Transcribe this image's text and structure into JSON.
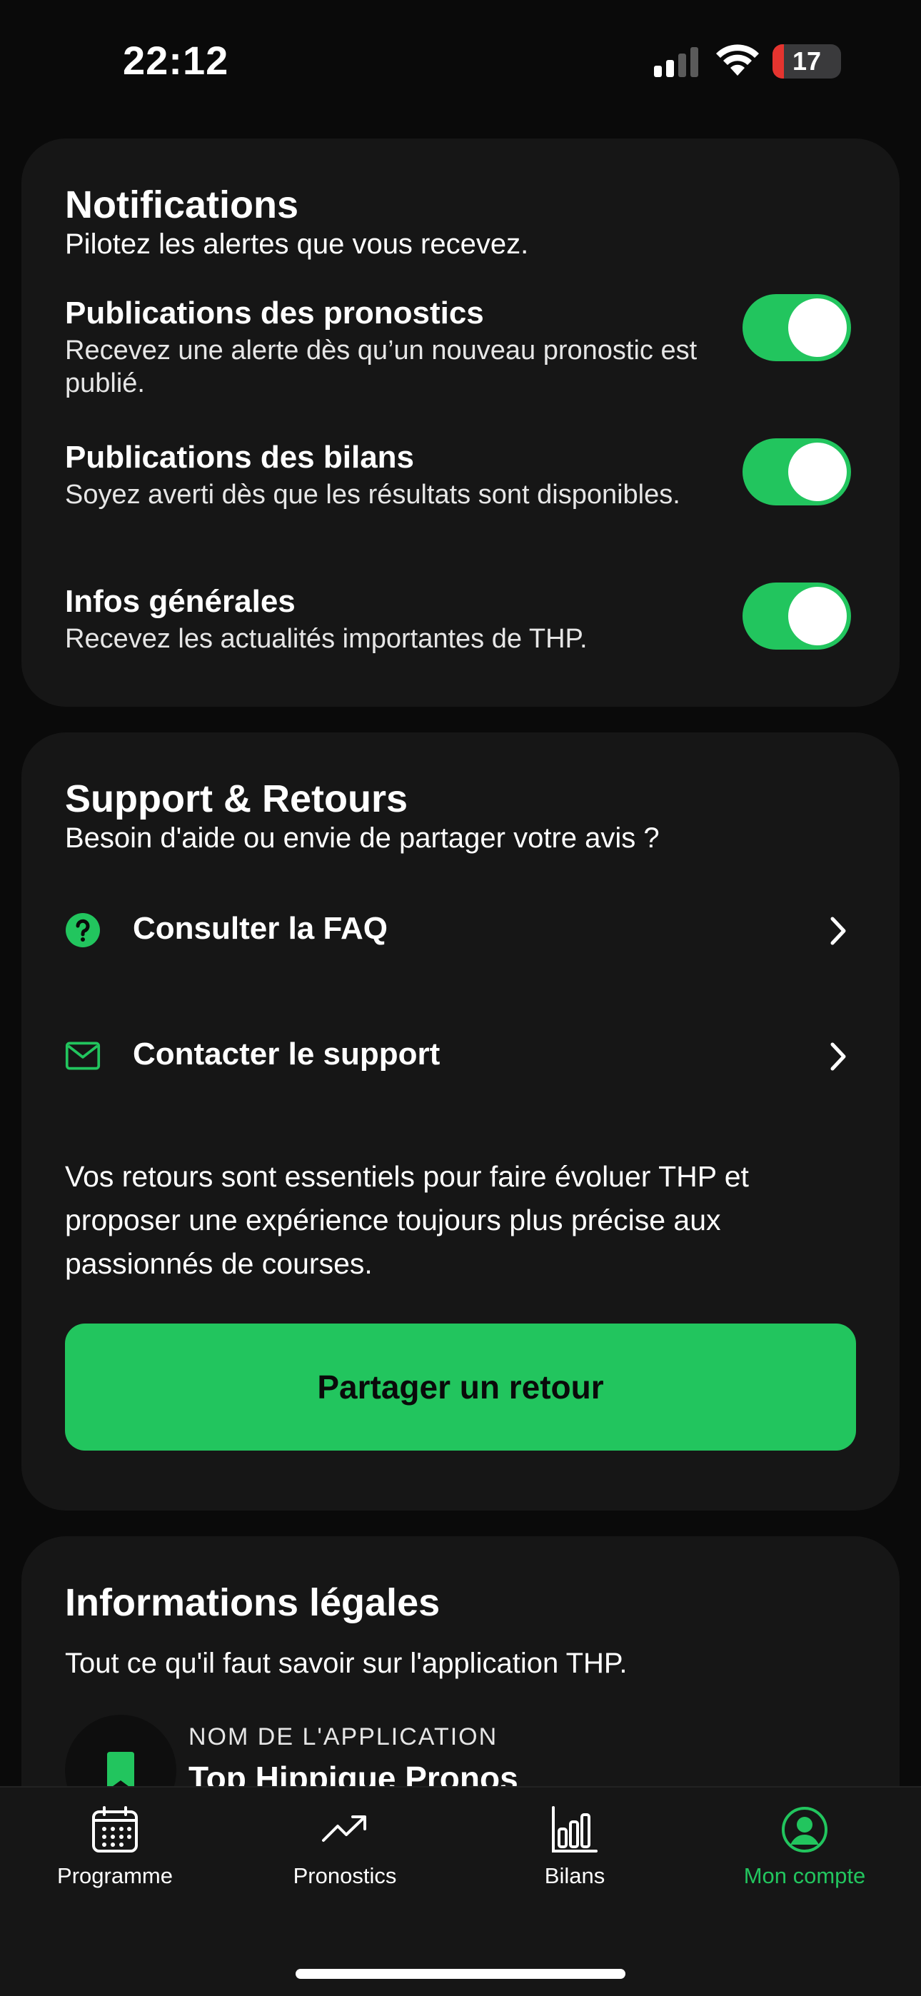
{
  "status_bar": {
    "time": "22:12",
    "battery_level": "17",
    "battery_fraction": 0.17
  },
  "notifications": {
    "title": "Notifications",
    "subtitle": "Pilotez les alertes que vous recevez.",
    "items": [
      {
        "title": "Publications des pronostics",
        "desc": "Recevez une alerte dès qu’un nouveau pronostic est publié.",
        "enabled": true
      },
      {
        "title": "Publications des bilans",
        "desc": "Soyez averti dès que les résultats sont disponibles.",
        "enabled": true
      },
      {
        "title": "Infos générales",
        "desc": "Recevez les actualités importantes de THP.",
        "enabled": true
      }
    ]
  },
  "support": {
    "title": "Support & Retours",
    "subtitle": "Besoin d'aide ou envie de partager votre avis ?",
    "faq_label": "Consulter la FAQ",
    "contact_label": "Contacter le support",
    "feedback_text": "Vos retours sont essentiels pour faire évoluer THP et proposer une expérience toujours plus précise aux passionnés de courses.",
    "cta_label": "Partager un retour"
  },
  "legal": {
    "title": "Informations légales",
    "subtitle": "Tout ce qu'il faut savoir sur l'application THP.",
    "app_name_label": "NOM DE L'APPLICATION",
    "app_name_value": "Top Hippique Pronos"
  },
  "tab_bar": {
    "items": [
      {
        "label": "Programme",
        "icon": "calendar-icon",
        "active": false
      },
      {
        "label": "Pronostics",
        "icon": "trend-up-icon",
        "active": false
      },
      {
        "label": "Bilans",
        "icon": "bar-chart-icon",
        "active": false
      },
      {
        "label": "Mon compte",
        "icon": "account-icon",
        "active": true
      }
    ]
  },
  "colors": {
    "accent": "#22c55e",
    "background": "#0a0a0a",
    "card": "#161616",
    "battery_low": "#e5342f"
  }
}
